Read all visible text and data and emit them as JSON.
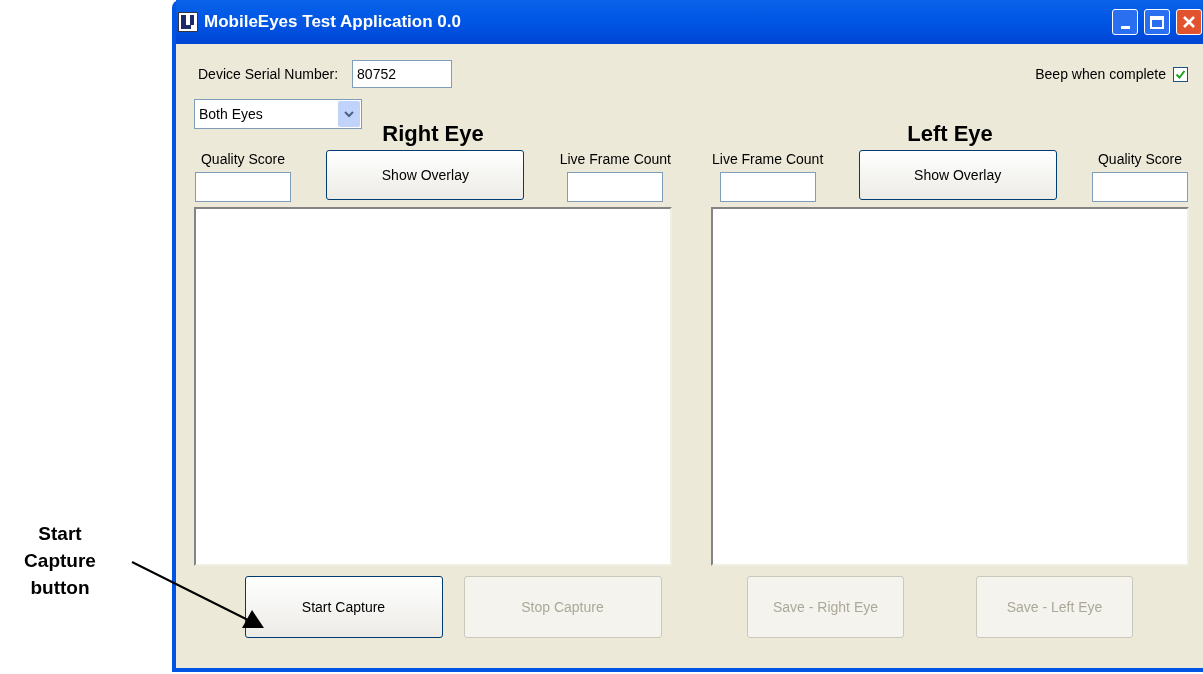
{
  "annotation": {
    "text": "Start Capture button"
  },
  "window": {
    "title": "MobileEyes Test Application 0.0"
  },
  "serial": {
    "label": "Device Serial Number:",
    "value": "80752"
  },
  "beep": {
    "label": "Beep when complete",
    "checked": true
  },
  "eye_select": {
    "value": "Both Eyes"
  },
  "panels": [
    {
      "title": "Right Eye",
      "left_field": {
        "label": "Quality Score"
      },
      "overlay_button": "Show Overlay",
      "right_field": {
        "label": "Live Frame Count"
      },
      "buttons": [
        {
          "label": "Start Capture",
          "disabled": false
        },
        {
          "label": "Stop Capture",
          "disabled": true
        }
      ]
    },
    {
      "title": "Left Eye",
      "left_field": {
        "label": "Live Frame Count"
      },
      "overlay_button": "Show Overlay",
      "right_field": {
        "label": "Quality Score"
      },
      "buttons": [
        {
          "label": "Save - Right Eye",
          "disabled": true
        },
        {
          "label": "Save - Left Eye",
          "disabled": true
        }
      ]
    }
  ]
}
